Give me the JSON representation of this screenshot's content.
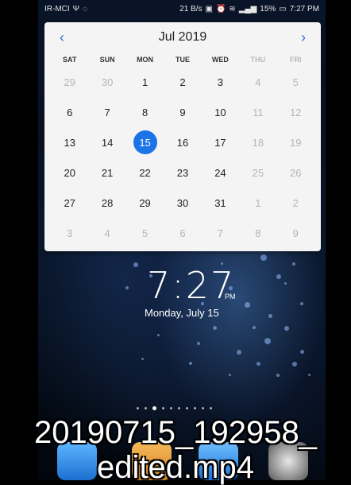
{
  "status_bar": {
    "carrier": "IR-MCI",
    "speed": "21 B/s",
    "battery": "15%",
    "time": "7:27 PM"
  },
  "calendar": {
    "month_title": "Jul 2019",
    "weekdays": [
      "SAT",
      "SUN",
      "MON",
      "TUE",
      "WED",
      "THU",
      "FRI"
    ],
    "weeks": [
      [
        "29",
        "30",
        "1",
        "2",
        "3",
        "4",
        "5"
      ],
      [
        "6",
        "7",
        "8",
        "9",
        "10",
        "11",
        "12"
      ],
      [
        "13",
        "14",
        "15",
        "16",
        "17",
        "18",
        "19"
      ],
      [
        "20",
        "21",
        "22",
        "23",
        "24",
        "25",
        "26"
      ],
      [
        "27",
        "28",
        "29",
        "30",
        "31",
        "1",
        "2"
      ],
      [
        "3",
        "4",
        "5",
        "6",
        "7",
        "8",
        "9"
      ]
    ],
    "selected": "15"
  },
  "lockscreen": {
    "time": "7:27",
    "ampm": "PM",
    "date": "Monday, July 15"
  },
  "overlay": {
    "filename_line1": "20190715_192958_",
    "filename_line2": "edited.mp4"
  }
}
